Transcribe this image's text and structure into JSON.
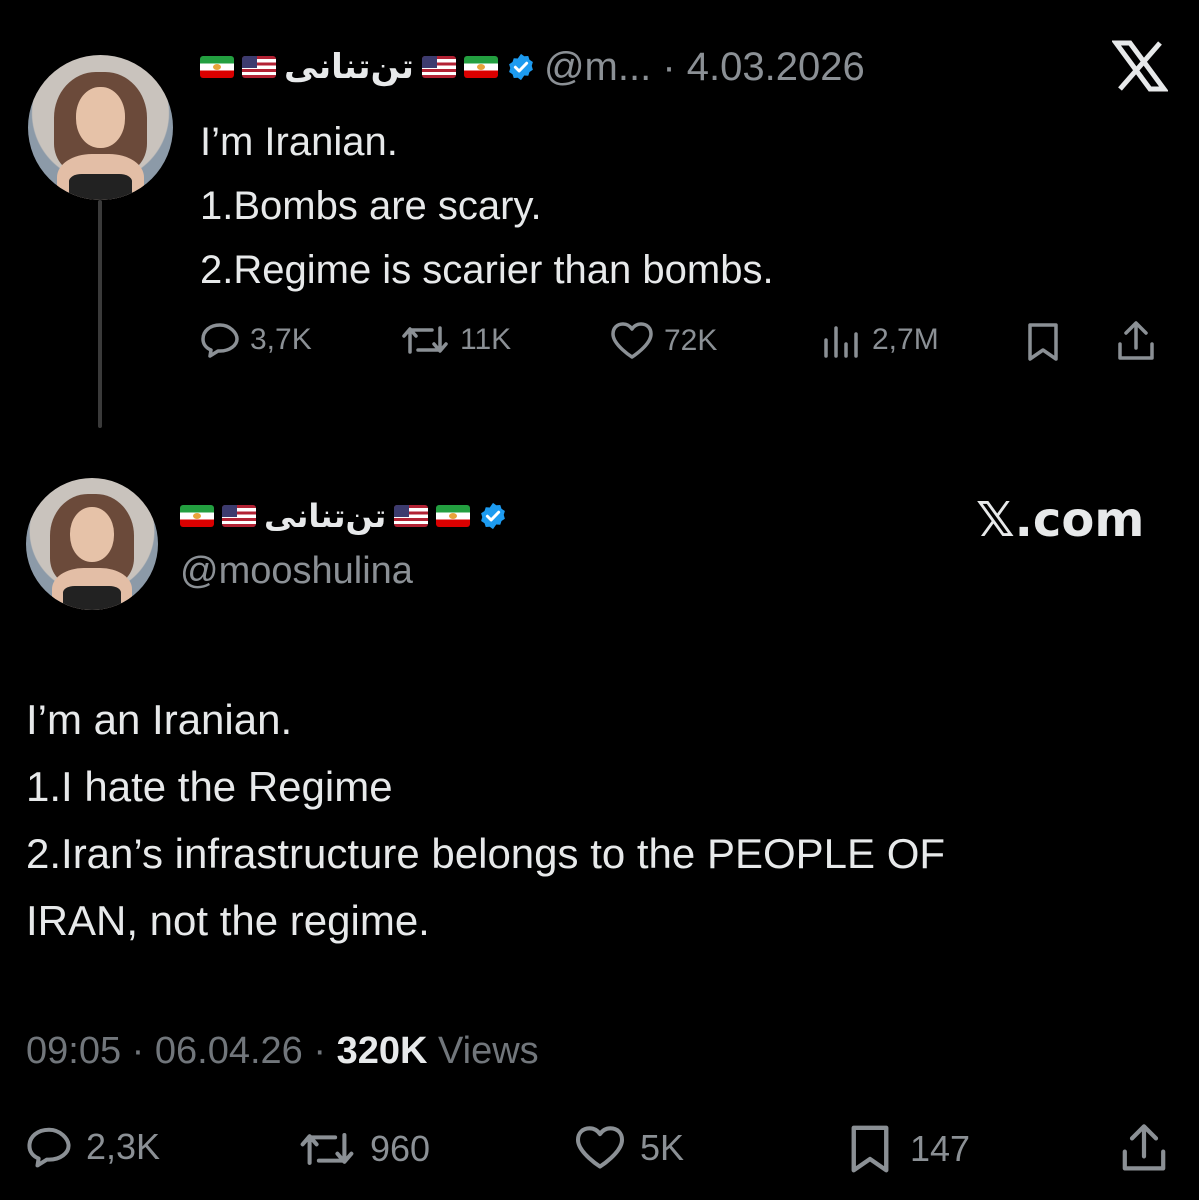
{
  "tweet1": {
    "display_name": "تن‌تنانی",
    "handle_date": "@m... · 4.03.2026",
    "lines": [
      "I’m Iranian.",
      "1.Bombs are scary.",
      "2.Regime is scarier than bombs."
    ],
    "stats": {
      "replies": "3,7K",
      "reposts": "11K",
      "likes": "72K",
      "views": "2,7M"
    }
  },
  "tweet2": {
    "display_name": "تن‌تنانی",
    "handle": "@mooshulina",
    "brand": "𝕏.com",
    "lines": [
      "I’m an Iranian.",
      "1.I hate the Regime",
      "2.Iran’s infrastructure belongs to the PEOPLE OF",
      "IRAN, not the regime."
    ],
    "meta": {
      "time_date": "09:05 · 06.04.26 · ",
      "views_count": "320K",
      "views_label": " Views"
    },
    "stats": {
      "replies": "2,3K",
      "reposts": "960",
      "likes": "5K",
      "bookmarks": "147"
    }
  },
  "icons": [
    "x-logo-icon",
    "verified-badge-icon",
    "reply-icon",
    "repost-icon",
    "like-icon",
    "views-icon",
    "bookmark-icon",
    "share-icon",
    "iran-flag-icon",
    "us-flag-icon"
  ],
  "colors": {
    "background": "#000000",
    "text": "#e7e9ea",
    "muted": "#71767b",
    "verified": "#1d9bf0"
  }
}
